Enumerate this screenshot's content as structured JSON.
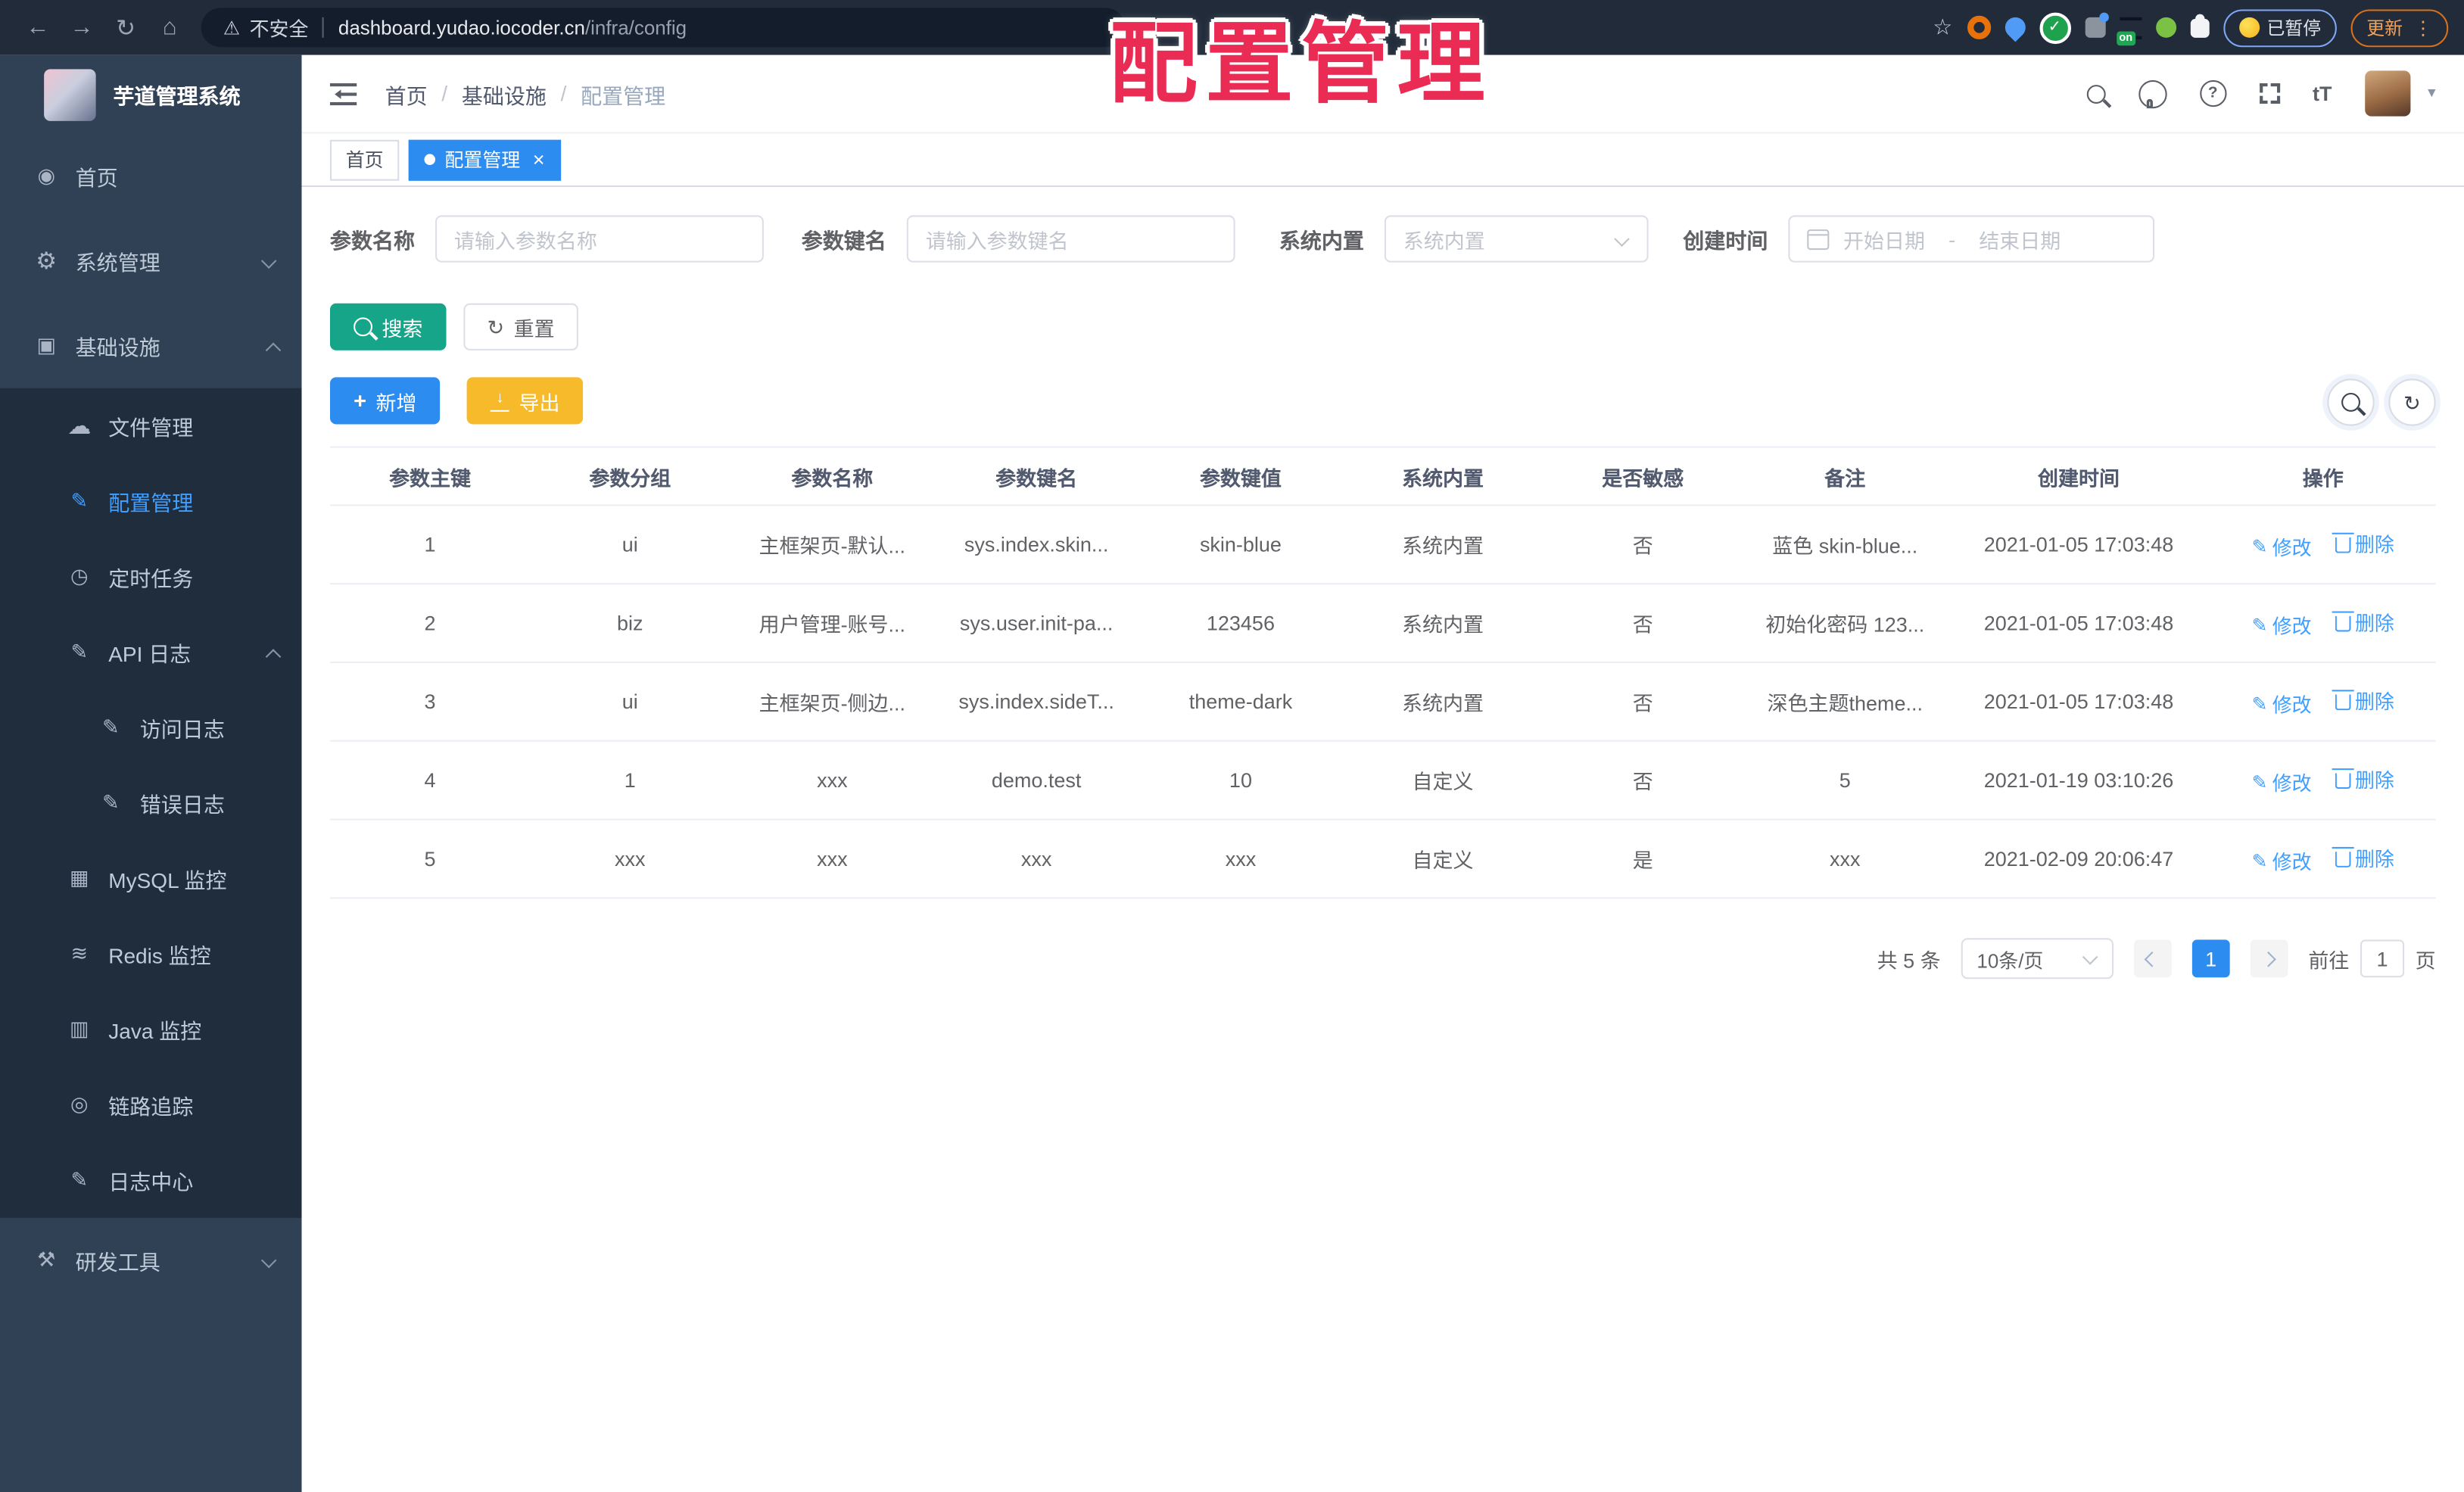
{
  "browser": {
    "security_label": "不安全",
    "url_host": "dashboard.yudao.iocoder.cn",
    "url_path": "/infra/config",
    "ext_on_badge": "on",
    "paused_badge": "已暂停",
    "update_button": "更新"
  },
  "watermark": "配置管理",
  "sidebar": {
    "app_title": "芋道管理系统",
    "items": [
      {
        "label": "首页",
        "icon": "dashboard-icon"
      },
      {
        "label": "系统管理",
        "icon": "gear-icon"
      },
      {
        "label": "基础设施",
        "icon": "infrastructure-icon"
      },
      {
        "label": "文件管理",
        "icon": "cloud-upload-icon"
      },
      {
        "label": "配置管理",
        "icon": "edit-icon",
        "active": true
      },
      {
        "label": "定时任务",
        "icon": "timer-icon"
      },
      {
        "label": "API 日志",
        "icon": "api-log-icon"
      },
      {
        "label": "访问日志",
        "icon": "access-log-icon"
      },
      {
        "label": "错误日志",
        "icon": "error-log-icon"
      },
      {
        "label": "MySQL 监控",
        "icon": "mysql-monitor-icon"
      },
      {
        "label": "Redis 监控",
        "icon": "redis-monitor-icon"
      },
      {
        "label": "Java 监控",
        "icon": "java-monitor-icon"
      },
      {
        "label": "链路追踪",
        "icon": "trace-icon"
      },
      {
        "label": "日志中心",
        "icon": "log-center-icon"
      },
      {
        "label": "研发工具",
        "icon": "dev-tools-icon"
      }
    ]
  },
  "breadcrumb": {
    "items": [
      "首页",
      "基础设施",
      "配置管理"
    ],
    "separator": "/"
  },
  "tabs": [
    {
      "label": "首页"
    },
    {
      "label": "配置管理",
      "active": true
    }
  ],
  "filters": {
    "name_label": "参数名称",
    "name_placeholder": "请输入参数名称",
    "key_label": "参数键名",
    "key_placeholder": "请输入参数键名",
    "type_label": "系统内置",
    "type_placeholder": "系统内置",
    "date_label": "创建时间",
    "date_start_placeholder": "开始日期",
    "date_separator": "-",
    "date_end_placeholder": "结束日期"
  },
  "actions": {
    "search": "搜索",
    "reset": "重置",
    "add": "新增",
    "export": "导出"
  },
  "table": {
    "columns": [
      "参数主键",
      "参数分组",
      "参数名称",
      "参数键名",
      "参数键值",
      "系统内置",
      "是否敏感",
      "备注",
      "创建时间",
      "操作"
    ],
    "edit_label": "修改",
    "delete_label": "删除",
    "rows": [
      {
        "cells": [
          "1",
          "ui",
          "主框架页-默认...",
          "sys.index.skin...",
          "skin-blue",
          "系统内置",
          "否",
          "蓝色 skin-blue...",
          "2021-01-05 17:03:48"
        ]
      },
      {
        "cells": [
          "2",
          "biz",
          "用户管理-账号...",
          "sys.user.init-pa...",
          "123456",
          "系统内置",
          "否",
          "初始化密码 123...",
          "2021-01-05 17:03:48"
        ]
      },
      {
        "cells": [
          "3",
          "ui",
          "主框架页-侧边...",
          "sys.index.sideT...",
          "theme-dark",
          "系统内置",
          "否",
          "深色主题theme...",
          "2021-01-05 17:03:48"
        ]
      },
      {
        "cells": [
          "4",
          "1",
          "xxx",
          "demo.test",
          "10",
          "自定义",
          "否",
          "5",
          "2021-01-19 03:10:26"
        ]
      },
      {
        "cells": [
          "5",
          "xxx",
          "xxx",
          "xxx",
          "xxx",
          "自定义",
          "是",
          "xxx",
          "2021-02-09 20:06:47"
        ]
      }
    ]
  },
  "pagination": {
    "total": "共 5 条",
    "page_size": "10条/页",
    "current_page": "1",
    "goto_label": "前往",
    "goto_value": "1",
    "page_suffix": "页"
  },
  "colors": {
    "primary": "#2d8cf0",
    "link": "#409eff",
    "success_teal": "#16a589",
    "warning_amber": "#f7ba2a",
    "watermark_red": "#ea2c55",
    "sidebar_bg": "#304156",
    "submenu_bg": "#1f2d3d",
    "chrome_bg": "#212b39"
  }
}
